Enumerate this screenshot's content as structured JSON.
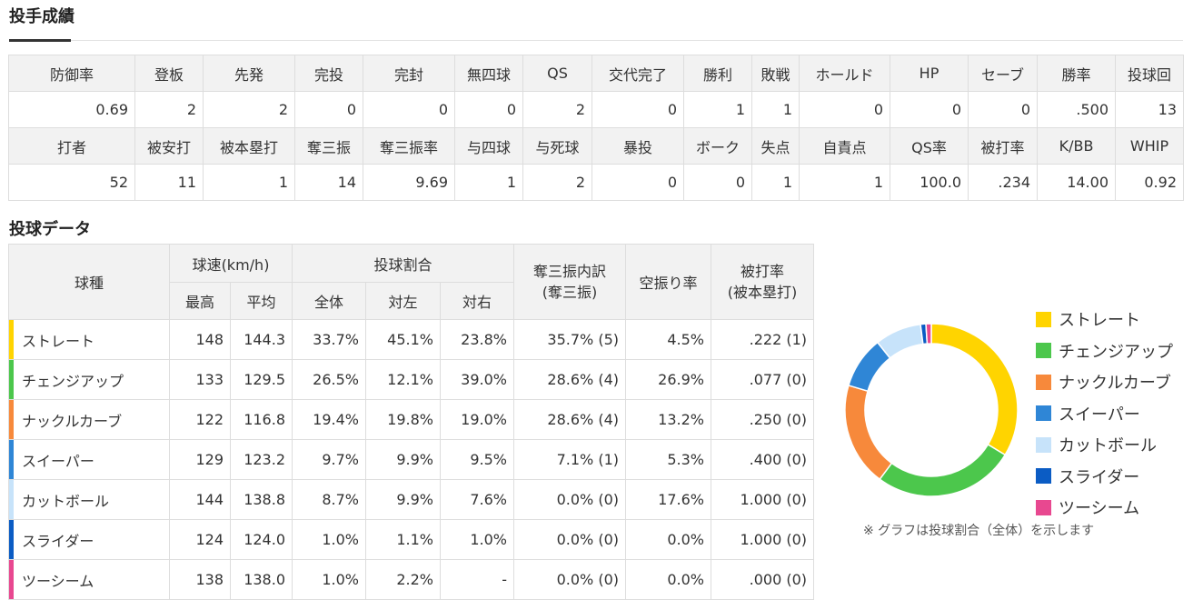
{
  "section1": {
    "title": "投手成績"
  },
  "stats": {
    "header1": [
      "防御率",
      "登板",
      "先発",
      "完投",
      "完封",
      "無四球",
      "QS",
      "交代完了",
      "勝利",
      "敗戦",
      "ホールド",
      "HP",
      "セーブ",
      "勝率",
      "投球回"
    ],
    "values1": [
      "0.69",
      "2",
      "2",
      "0",
      "0",
      "0",
      "2",
      "0",
      "1",
      "1",
      "0",
      "0",
      "0",
      ".500",
      "13"
    ],
    "header2": [
      "打者",
      "被安打",
      "被本塁打",
      "奪三振",
      "奪三振率",
      "与四球",
      "与死球",
      "暴投",
      "ボーク",
      "失点",
      "自責点",
      "QS率",
      "被打率",
      "K/BB",
      "WHIP"
    ],
    "values2": [
      "52",
      "11",
      "1",
      "14",
      "9.69",
      "1",
      "2",
      "0",
      "0",
      "1",
      "1",
      "100.0",
      ".234",
      "14.00",
      "0.92"
    ]
  },
  "section2": {
    "title": "投球データ"
  },
  "pitch_table": {
    "headers": {
      "type": "球種",
      "speed": "球速(km/h)",
      "ratio": "投球割合",
      "k_line1": "奪三振内訳",
      "k_line2": "(奪三振)",
      "whiff": "空振り率",
      "avg_line1": "被打率",
      "avg_line2": "(被本塁打)",
      "max": "最高",
      "avgspeed": "平均",
      "all": "全体",
      "vs_left": "対左",
      "vs_right": "対右"
    },
    "rows": [
      {
        "name": "ストレート",
        "color": "#ffd400",
        "max": "148",
        "avg": "144.3",
        "all": "33.7%",
        "left": "45.1%",
        "right": "23.8%",
        "k": "35.7% (5)",
        "whiff": "4.5%",
        "ba": ".222 (1)"
      },
      {
        "name": "チェンジアップ",
        "color": "#4cc74c",
        "max": "133",
        "avg": "129.5",
        "all": "26.5%",
        "left": "12.1%",
        "right": "39.0%",
        "k": "28.6% (4)",
        "whiff": "26.9%",
        "ba": ".077 (0)"
      },
      {
        "name": "ナックルカーブ",
        "color": "#f7893b",
        "max": "122",
        "avg": "116.8",
        "all": "19.4%",
        "left": "19.8%",
        "right": "19.0%",
        "k": "28.6% (4)",
        "whiff": "13.2%",
        "ba": ".250 (0)"
      },
      {
        "name": "スイーパー",
        "color": "#2f86d6",
        "max": "129",
        "avg": "123.2",
        "all": "9.7%",
        "left": "9.9%",
        "right": "9.5%",
        "k": "7.1% (1)",
        "whiff": "5.3%",
        "ba": ".400 (0)"
      },
      {
        "name": "カットボール",
        "color": "#c7e3fa",
        "max": "144",
        "avg": "138.8",
        "all": "8.7%",
        "left": "9.9%",
        "right": "7.6%",
        "k": "0.0% (0)",
        "whiff": "17.6%",
        "ba": "1.000 (0)"
      },
      {
        "name": "スライダー",
        "color": "#0b5cc4",
        "max": "124",
        "avg": "124.0",
        "all": "1.0%",
        "left": "1.1%",
        "right": "1.0%",
        "k": "0.0% (0)",
        "whiff": "0.0%",
        "ba": "1.000 (0)"
      },
      {
        "name": "ツーシーム",
        "color": "#e84890",
        "max": "138",
        "avg": "138.0",
        "all": "1.0%",
        "left": "2.2%",
        "right": "-",
        "k": "0.0% (0)",
        "whiff": "0.0%",
        "ba": ".000 (0)"
      }
    ]
  },
  "chart_data": {
    "type": "pie",
    "variant": "donut",
    "categories": [
      "ストレート",
      "チェンジアップ",
      "ナックルカーブ",
      "スイーパー",
      "カットボール",
      "スライダー",
      "ツーシーム"
    ],
    "values": [
      33.7,
      26.5,
      19.4,
      9.7,
      8.7,
      1.0,
      1.0
    ],
    "colors": [
      "#ffd400",
      "#4cc74c",
      "#f7893b",
      "#2f86d6",
      "#c7e3fa",
      "#0b5cc4",
      "#e84890"
    ],
    "legend_position": "right",
    "note": "※ グラフは投球割合（全体）を示します"
  }
}
